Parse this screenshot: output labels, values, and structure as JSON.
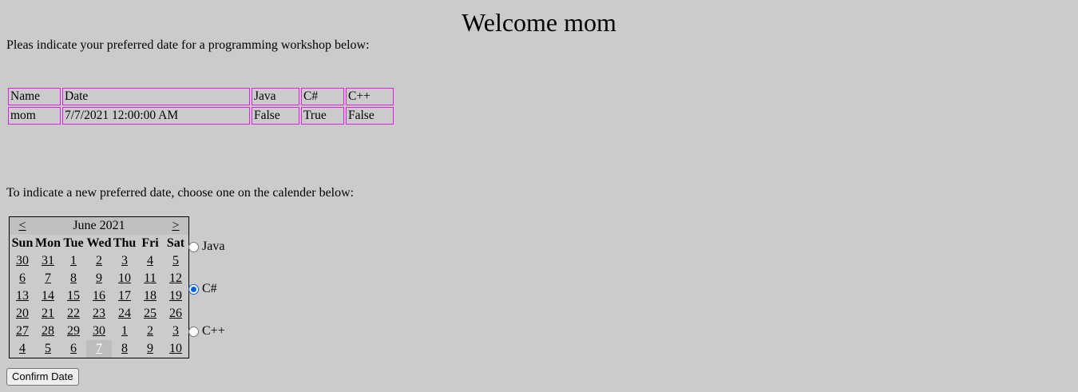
{
  "page": {
    "title": "Welcome mom",
    "intro": "Pleas indicate your preferred date for a programming workshop below:",
    "choose_text": "To indicate a new preferred date, choose one on the calender below:"
  },
  "results_table": {
    "headers": [
      "Name",
      "Date",
      "Java",
      "C#",
      "C++"
    ],
    "rows": [
      [
        "mom",
        "7/7/2021 12:00:00 AM",
        "False",
        "True",
        "False"
      ]
    ],
    "border_color": "#e020e0"
  },
  "calendar": {
    "prev": "<",
    "next": ">",
    "month": "June 2021",
    "weekdays": [
      "Sun",
      "Mon",
      "Tue",
      "Wed",
      "Thu",
      "Fri",
      "Sat"
    ],
    "weeks": [
      [
        "30",
        "31",
        "1",
        "2",
        "3",
        "4",
        "5"
      ],
      [
        "6",
        "7",
        "8",
        "9",
        "10",
        "11",
        "12"
      ],
      [
        "13",
        "14",
        "15",
        "16",
        "17",
        "18",
        "19"
      ],
      [
        "20",
        "21",
        "22",
        "23",
        "24",
        "25",
        "26"
      ],
      [
        "27",
        "28",
        "29",
        "30",
        "1",
        "2",
        "3"
      ],
      [
        "4",
        "5",
        "6",
        "7",
        "8",
        "9",
        "10"
      ]
    ],
    "selected": "7"
  },
  "language_options": [
    {
      "label": "Java",
      "checked": false
    },
    {
      "label": "C#",
      "checked": true
    },
    {
      "label": "C++",
      "checked": false
    }
  ],
  "confirm_label": "Confirm Date",
  "colors": {
    "background": "#cbcbcb",
    "radio_accent": "#0060df"
  }
}
